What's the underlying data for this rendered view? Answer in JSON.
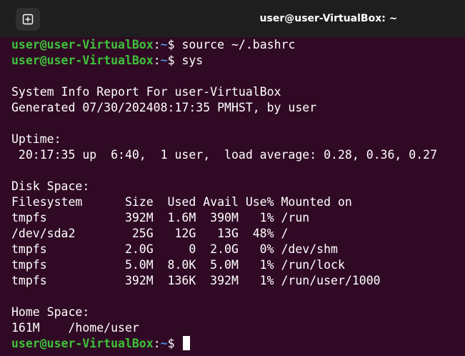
{
  "window": {
    "title": "user@user-VirtualBox: ~",
    "new_tab_icon": "new-tab-icon"
  },
  "prompt": {
    "user_host": "user@user-VirtualBox",
    "separator": ":",
    "path": "~",
    "dollar": "$ "
  },
  "commands": {
    "cmd1": "source ~/.bashrc",
    "cmd2": "sys"
  },
  "output": {
    "report_title": "System Info Report For user-VirtualBox",
    "generated": "Generated 07/30/202408:17:35 PMHST, by user",
    "uptime_label": "Uptime:",
    "uptime_value": " 20:17:35 up  6:40,  1 user,  load average: 0.28, 0.36, 0.27",
    "disk_label": "Disk Space:",
    "disk_header": "Filesystem      Size  Used Avail Use% Mounted on",
    "disk_rows": [
      "tmpfs           392M  1.6M  390M   1% /run",
      "/dev/sda2        25G   12G   13G  48% /",
      "tmpfs           2.0G     0  2.0G   0% /dev/shm",
      "tmpfs           5.0M  8.0K  5.0M   1% /run/lock",
      "tmpfs           392M  136K  392M   1% /run/user/1000"
    ],
    "home_label": "Home Space:",
    "home_value": "161M    /home/user"
  },
  "colors": {
    "background": "#300a24",
    "titlebar": "#1e1e1e",
    "prompt_user": "#3ec23a",
    "prompt_path": "#4a8fd8",
    "text": "#ffffff"
  }
}
